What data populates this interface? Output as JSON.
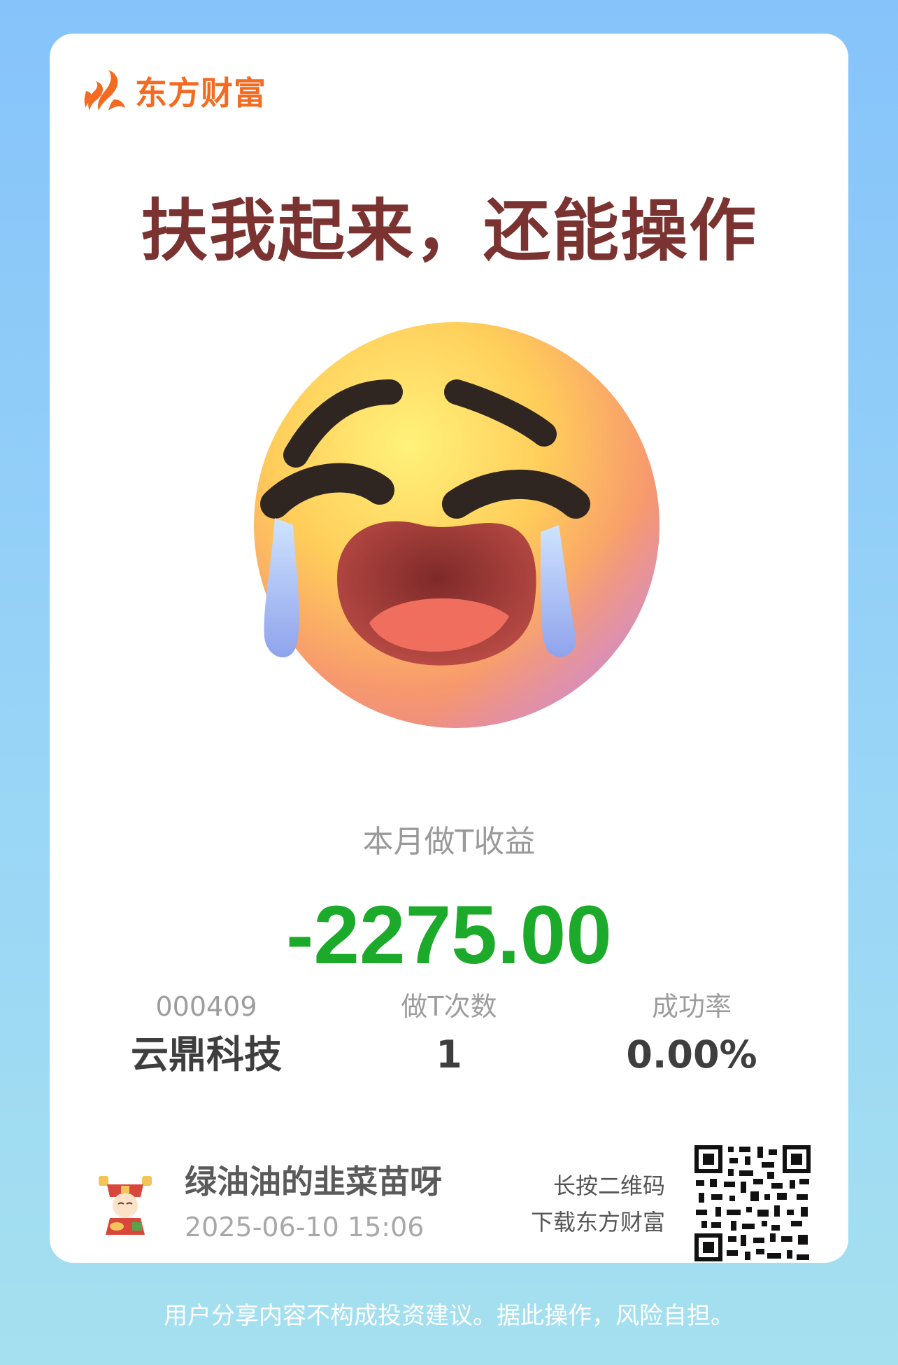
{
  "brand": {
    "name": "东方财富",
    "color": "#f46a21",
    "icon": "east-money-flame-logo"
  },
  "headline": "扶我起来，还能操作",
  "emoji": {
    "icon": "crying-face-emoji"
  },
  "summary": {
    "label": "本月做T收益",
    "amount": "-2275.00",
    "amount_color": "#1caa2a"
  },
  "stats": {
    "stock": {
      "code": "000409",
      "name": "云鼎科技"
    },
    "trade_count": {
      "label": "做T次数",
      "value": "1"
    },
    "success_rate": {
      "label": "成功率",
      "value": "0.00%"
    }
  },
  "user": {
    "name": "绿油油的韭菜苗呀",
    "share_time": "2025-06-10 15:06",
    "avatar_icon": "god-of-wealth-avatar"
  },
  "qr": {
    "hint_line1": "长按二维码",
    "hint_line2": "下载东方财富",
    "icon": "qr-code"
  },
  "disclaimer": "用户分享内容不构成投资建议。据此操作，风险自担。",
  "colors": {
    "headline": "#7a3330",
    "background_top": "#86c3fa",
    "background_bottom": "#a5e0ef"
  }
}
